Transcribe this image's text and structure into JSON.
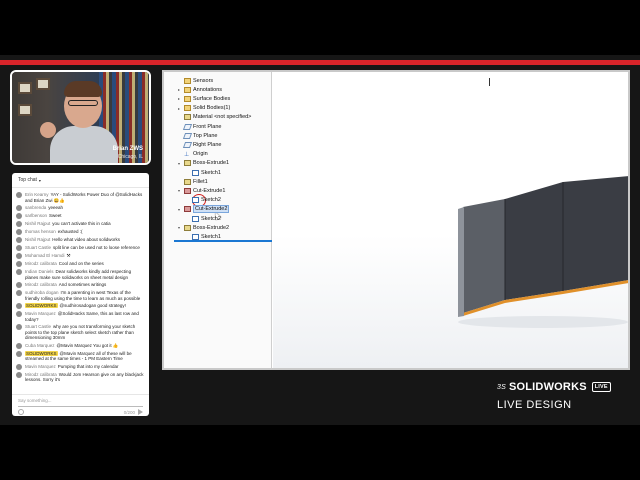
{
  "stream": {
    "presenter_name": "Brian ZWS",
    "presenter_location": "Chicago, IL"
  },
  "chat": {
    "header": "Top chat",
    "messages": [
      {
        "author": "Erin Kearny",
        "text": "YAY - SolidWorks Power Duo of @SolidHacks and Brian Zwi 😀👍"
      },
      {
        "author": "sanbrenda",
        "text": "yeeeah"
      },
      {
        "author": "sarlbenson",
        "text": "Sweet"
      },
      {
        "author": "Nishil Rajput",
        "text": "you can't activate this in catia"
      },
      {
        "author": "thomas henson",
        "text": "exhausted :("
      },
      {
        "author": "Nishil Rajput",
        "text": "Hello what video about solidworks"
      },
      {
        "author": "Stuart Castle",
        "text": "split line can be used not to loose reference"
      },
      {
        "author": "Mohamad El Hamdi",
        "text": "⚒"
      },
      {
        "author": "Mirodz calibrata",
        "text": "Cool and on the series"
      },
      {
        "author": "Indian Daniels",
        "text": "Dear solidworks kindly add respecting planes make sure solidworks on sheet metal design"
      },
      {
        "author": "Mirodz calibrata",
        "text": "And sometimes writings"
      },
      {
        "author": "sudhiroba dogan",
        "text": "I'm a parenting in west Texas of the friendly rolling using the time to learn as much as possible"
      },
      {
        "author": "SOLIDWORKS",
        "mod": true,
        "text": "@sudhirosadogan good strategy!"
      },
      {
        "author": "Mavin Marquez",
        "text": "@SolidHacks Same, this as last row and today?"
      },
      {
        "author": "Stuart Castle",
        "text": "why are you not transforming your sketch points to the top plane sketch select sketch rather than dimensioning 30mm"
      },
      {
        "author": "Cuba Marquez",
        "text": "@Mavin Marquez You got it 👍"
      },
      {
        "author": "SOLIDWORKS",
        "mod": true,
        "text": "@Mavin Marquez all of these will be streamed at the same times - 1 PM Eastern Time"
      },
      {
        "author": "Mavin Marquez",
        "text": "Pumping that into my calendar"
      },
      {
        "author": "Mirodz calibrata",
        "text": "Would Jom Hearson give on any blackjack lessons. Sorry it's"
      }
    ],
    "input_placeholder": "Say something...",
    "char_count": "0/200"
  },
  "feature_tree": {
    "items": [
      {
        "label": "Sensors",
        "icon": "folder-icon",
        "expander": ""
      },
      {
        "label": "Annotations",
        "icon": "annotation-icon",
        "expander": "▸"
      },
      {
        "label": "Surface Bodies",
        "icon": "folder-icon",
        "expander": "▸"
      },
      {
        "label": "Solid Bodies(1)",
        "icon": "folder-icon",
        "expander": "▸"
      },
      {
        "label": "Material <not specified>",
        "icon": "material-icon",
        "expander": ""
      },
      {
        "label": "Front Plane",
        "icon": "plane-icon",
        "expander": ""
      },
      {
        "label": "Top Plane",
        "icon": "plane-icon",
        "expander": ""
      },
      {
        "label": "Right Plane",
        "icon": "plane-icon",
        "expander": ""
      },
      {
        "label": "Origin",
        "icon": "origin-icon",
        "expander": ""
      },
      {
        "label": "Boss-Extrude1",
        "icon": "boss-extrude-icon",
        "expander": "▾"
      },
      {
        "label": "Sketch1",
        "icon": "sketch-icon",
        "expander": "",
        "indent": true
      },
      {
        "label": "Fillet1",
        "icon": "fillet-icon",
        "expander": ""
      },
      {
        "label": "Cut-Extrude1",
        "icon": "cut-extrude-icon",
        "expander": "▾"
      },
      {
        "label": "Sketch2",
        "icon": "sketch-icon",
        "expander": "",
        "indent": true
      },
      {
        "label": "Cut-Extrude2",
        "icon": "cut-extrude-icon",
        "expander": "▾",
        "selected": true
      },
      {
        "label": "Sketch2",
        "icon": "sketch-icon",
        "expander": "",
        "indent": true
      },
      {
        "label": "Boss-Extrude2",
        "icon": "boss-extrude-icon",
        "expander": "▾"
      },
      {
        "label": "Sketch1",
        "icon": "sketch-icon",
        "expander": "",
        "indent": true
      }
    ]
  },
  "branding": {
    "ds_mark": "3S",
    "product": "SOLIDWORKS",
    "badge": "LIVE",
    "show_title": "LIVE DESIGN"
  },
  "colors": {
    "accent_red": "#d8242a",
    "model_face": "#3a3d44",
    "model_edge": "#e0902a",
    "selection_blue": "#1a77d2"
  }
}
